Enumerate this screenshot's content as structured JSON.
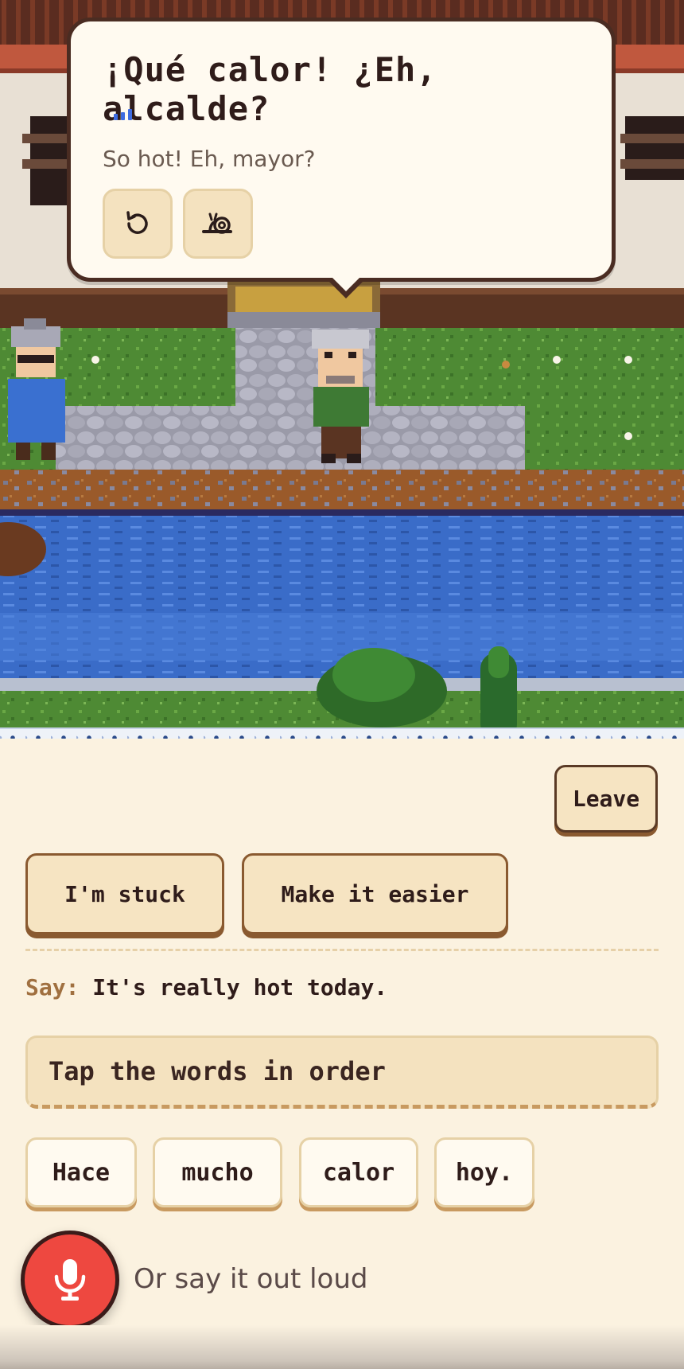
{
  "scene": {
    "npc_left": "grandmother-villager",
    "npc_center": "mayor-villager"
  },
  "bubble": {
    "title": "¡Qué calor! ¿Eh, alcalde?",
    "translation": "So hot! Eh, mayor?",
    "replay_icon": "replay-icon",
    "slow_icon": "snail-icon"
  },
  "actions": {
    "leave_label": "Leave",
    "stuck_label": "I'm stuck",
    "easier_label": "Make it easier"
  },
  "exercise": {
    "say_label": "Say:",
    "say_text": "It's really hot today.",
    "answer_placeholder": "Tap the words in order",
    "word_bank": [
      "Hace",
      "mucho",
      "calor",
      "hoy."
    ]
  },
  "voice": {
    "mic_icon": "microphone-icon",
    "hint": "Or say it out loud"
  },
  "colors": {
    "background": "#fbf2e0",
    "mic_red": "#ee4840",
    "button_fill": "#f6e4c2",
    "water": "#3a6cc8"
  }
}
